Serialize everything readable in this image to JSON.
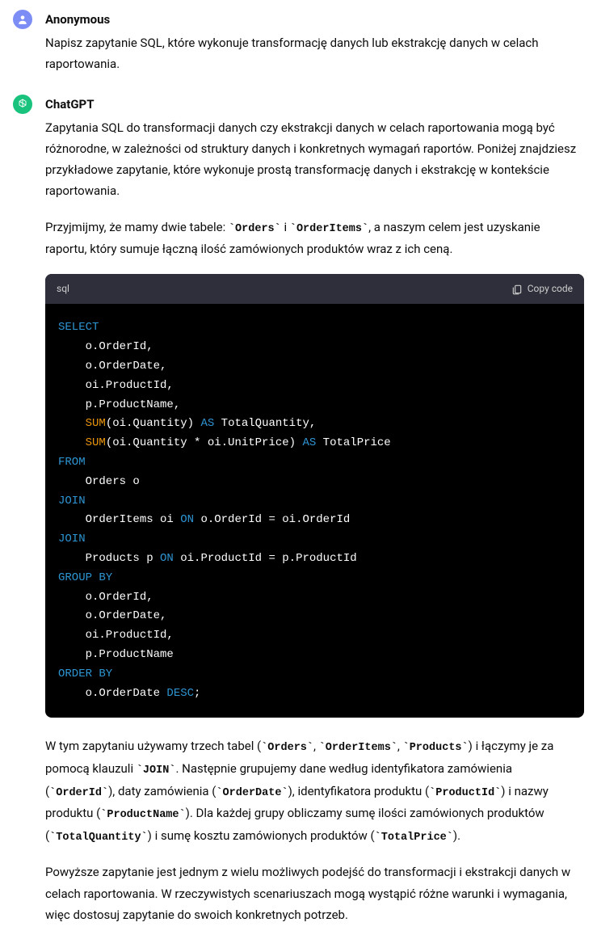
{
  "messages": {
    "user": {
      "author": "Anonymous",
      "text": "Napisz zapytanie SQL, które wykonuje transformację danych lub ekstrakcję danych w celach raportowania."
    },
    "assistant": {
      "author": "ChatGPT",
      "p1": "Zapytania SQL do transformacji danych czy ekstrakcji danych w celach raportowania mogą być różnorodne, w zależności od struktury danych i konkretnych wymagań raportów. Poniżej znajdziesz przykładowe zapytanie, które wykonuje prostą transformację danych i ekstrakcję w kontekście raportowania.",
      "p2_pre": "Przyjmijmy, że mamy dwie tabele: ",
      "p2_c1": "`Orders`",
      "p2_mid1": " i ",
      "p2_c2": "`OrderItems`",
      "p2_post": ", a naszym celem jest uzyskanie raportu, który sumuje łączną ilość zamówionych produktów wraz z ich ceną.",
      "code": {
        "lang": "sql",
        "copy_label": "Copy code",
        "tokens": {
          "select": "SELECT",
          "l1": "    o.OrderId,",
          "l2": "    o.OrderDate,",
          "l3": "    oi.ProductId,",
          "l4": "    p.ProductName,",
          "sum1": "SUM",
          "sum1_args": "(oi.Quantity) ",
          "as1": "AS",
          "as1_post": " TotalQuantity,",
          "sum2": "SUM",
          "sum2_args": "(oi.Quantity * oi.UnitPrice) ",
          "as2": "AS",
          "as2_post": " TotalPrice",
          "from": "FROM",
          "from_body": "    Orders o",
          "join1": "JOIN",
          "join1_body_pre": "    OrderItems oi ",
          "on1": "ON",
          "join1_body_post": " o.OrderId = oi.OrderId",
          "join2": "JOIN",
          "join2_body_pre": "    Products p ",
          "on2": "ON",
          "join2_body_post": " oi.ProductId = p.ProductId",
          "groupby": "GROUP BY",
          "g1": "    o.OrderId,",
          "g2": "    o.OrderDate,",
          "g3": "    oi.ProductId,",
          "g4": "    p.ProductName",
          "orderby": "ORDER BY",
          "ob_pre": "    o.OrderDate ",
          "desc": "DESC",
          "semi": ";"
        }
      },
      "p3_1": "W tym zapytaniu używamy trzech tabel (",
      "p3_c1": "`Orders`",
      "p3_2": ", ",
      "p3_c2": "`OrderItems`",
      "p3_3": ", ",
      "p3_c3": "`Products`",
      "p3_4": ") i łączymy je za pomocą klauzuli ",
      "p3_c4": "`JOIN`",
      "p3_5": ". Następnie grupujemy dane według identyfikatora zamówienia (",
      "p3_c5": "`OrderId`",
      "p3_6": "), daty zamówienia (",
      "p3_c6": "`OrderDate`",
      "p3_7": "), identyfikatora produktu (",
      "p3_c7": "`ProductId`",
      "p3_8": ") i nazwy produktu (",
      "p3_c8": "`ProductName`",
      "p3_9": "). Dla każdej grupy obliczamy sumę ilości zamówionych produktów (",
      "p3_c9": "`TotalQuantity`",
      "p3_10": ") i sumę kosztu zamówionych produktów (",
      "p3_c10": "`TotalPrice`",
      "p3_11": ").",
      "p4": "Powyższe zapytanie jest jednym z wielu możliwych podejść do transformacji i ekstrakcji danych w celach raportowania. W rzeczywistych scenariuszach mogą wystąpić różne warunki i wymagania, więc dostosuj zapytanie do swoich konkretnych potrzeb."
    }
  }
}
